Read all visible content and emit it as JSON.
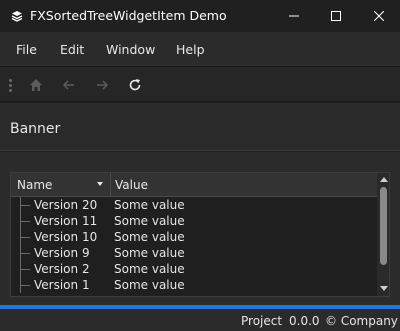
{
  "window": {
    "title": "FXSortedTreeWidgetItem Demo",
    "app_icon": "layers-icon",
    "controls": [
      "minimize-icon",
      "maximize-icon",
      "close-icon"
    ]
  },
  "menubar": {
    "items": [
      "File",
      "Edit",
      "Window",
      "Help"
    ]
  },
  "toolbar": {
    "buttons": [
      {
        "icon": "home-icon",
        "enabled": false
      },
      {
        "icon": "back-arrow-icon",
        "enabled": false
      },
      {
        "icon": "forward-arrow-icon",
        "enabled": false
      },
      {
        "icon": "refresh-icon",
        "enabled": true
      }
    ]
  },
  "banner": {
    "text": "Banner"
  },
  "tree": {
    "columns": [
      "Name",
      "Value"
    ],
    "sort_indicator": "descending",
    "rows": [
      {
        "name": "Version 20",
        "value": "Some value"
      },
      {
        "name": "Version 11",
        "value": "Some value"
      },
      {
        "name": "Version 10",
        "value": "Some value"
      },
      {
        "name": "Version 9",
        "value": "Some value"
      },
      {
        "name": "Version 2",
        "value": "Some value"
      },
      {
        "name": "Version 1",
        "value": "Some value"
      }
    ]
  },
  "statusbar": {
    "project": "Project",
    "version": "0.0.0",
    "company": "© Company"
  },
  "colors": {
    "accent": "#1f7ad6",
    "background": "#202020",
    "panel": "#2b2b2b"
  }
}
